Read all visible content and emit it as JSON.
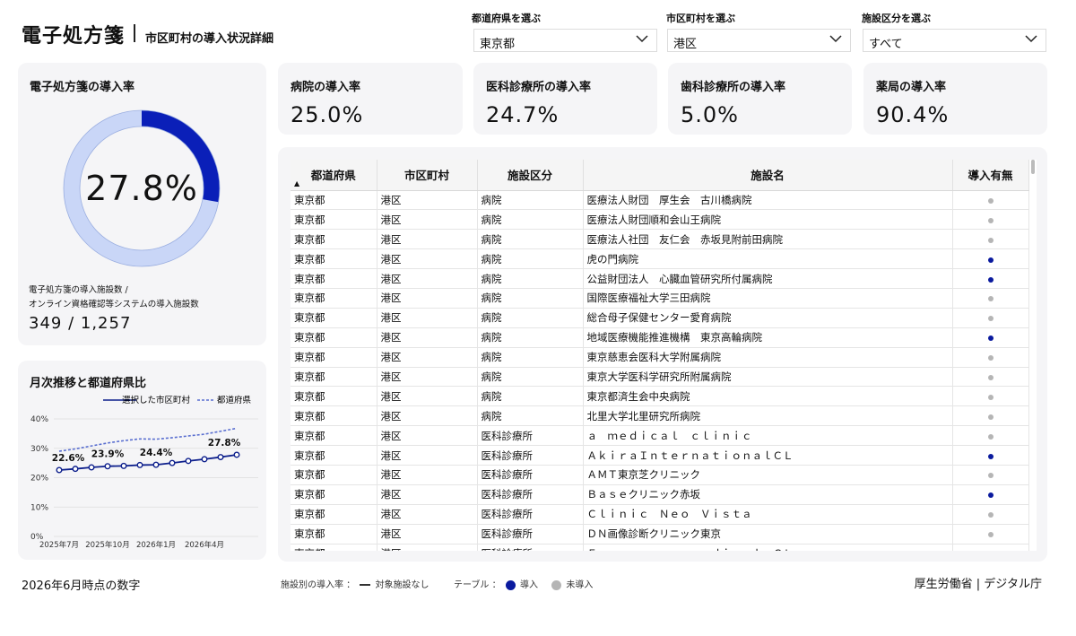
{
  "header": {
    "title": "電子処方箋",
    "subtitle": "市区町村の導入状況詳細"
  },
  "filters": [
    {
      "label": "都道府県を選ぶ",
      "value": "東京都"
    },
    {
      "label": "市区町村を選ぶ",
      "value": "港区"
    },
    {
      "label": "施設区分を選ぶ",
      "value": "すべて"
    }
  ],
  "overall": {
    "title": "電子処方箋の導入率",
    "rate": "27.8%",
    "rate_fraction": 0.278,
    "caption_line1": "電子処方箋の導入施設数 /",
    "caption_line2": "オンライン資格確認等システムの導入施設数",
    "counts": "349 / 1,257"
  },
  "kpis": [
    {
      "title": "病院の導入率",
      "value": "25.0%"
    },
    {
      "title": "医科診療所の導入率",
      "value": "24.7%"
    },
    {
      "title": "歯科診療所の導入率",
      "value": "5.0%"
    },
    {
      "title": "薬局の導入率",
      "value": "90.4%"
    }
  ],
  "trend": {
    "title": "月次推移と都道府県比",
    "legend_selected": "選択した市区町村",
    "legend_pref": "都道府県"
  },
  "chart_data": {
    "type": "line",
    "x": [
      "2025年7月",
      "2025年8月",
      "2025年9月",
      "2025年10月",
      "2025年11月",
      "2025年12月",
      "2026年1月",
      "2026年2月",
      "2026年3月",
      "2026年4月",
      "2026年5月",
      "2026年6月"
    ],
    "x_tick_labels": [
      "2025年7月",
      "2025年10月",
      "2026年1月",
      "2026年4月"
    ],
    "y_tick_labels": [
      "0%",
      "10%",
      "20%",
      "30%",
      "40%"
    ],
    "ylim": [
      0,
      40
    ],
    "series": [
      {
        "name": "選択した市区町村",
        "values": [
          22.6,
          23.0,
          23.5,
          23.9,
          24.0,
          24.3,
          24.4,
          25.0,
          25.7,
          26.3,
          27.0,
          27.8
        ],
        "color": "#0d1f8c"
      },
      {
        "name": "都道府県",
        "values": [
          29.0,
          29.8,
          30.8,
          31.8,
          32.6,
          33.2,
          33.1,
          33.6,
          34.2,
          34.8,
          35.8,
          36.8
        ],
        "color": "#5a6fd0"
      }
    ],
    "point_labels": [
      {
        "index": 0,
        "text": "22.6%"
      },
      {
        "index": 3,
        "text": "23.9%"
      },
      {
        "index": 6,
        "text": "24.4%"
      },
      {
        "index": 11,
        "text": "27.8%"
      }
    ]
  },
  "table": {
    "headers": [
      "都道府県",
      "市区町村",
      "施設区分",
      "施設名",
      "導入有無"
    ],
    "sort_indicator": "▲",
    "rows": [
      [
        "東京都",
        "港区",
        "病院",
        "医療法人財団　厚生会　古川橋病院",
        false
      ],
      [
        "東京都",
        "港区",
        "病院",
        "医療法人財団順和会山王病院",
        false
      ],
      [
        "東京都",
        "港区",
        "病院",
        "医療法人社団　友仁会　赤坂見附前田病院",
        false
      ],
      [
        "東京都",
        "港区",
        "病院",
        "虎の門病院",
        true
      ],
      [
        "東京都",
        "港区",
        "病院",
        "公益財団法人　心臓血管研究所付属病院",
        true
      ],
      [
        "東京都",
        "港区",
        "病院",
        "国際医療福祉大学三田病院",
        false
      ],
      [
        "東京都",
        "港区",
        "病院",
        "総合母子保健センター愛育病院",
        false
      ],
      [
        "東京都",
        "港区",
        "病院",
        "地域医療機能推進機構　東京高輪病院",
        true
      ],
      [
        "東京都",
        "港区",
        "病院",
        "東京慈恵会医科大学附属病院",
        false
      ],
      [
        "東京都",
        "港区",
        "病院",
        "東京大学医科学研究所附属病院",
        false
      ],
      [
        "東京都",
        "港区",
        "病院",
        "東京都済生会中央病院",
        false
      ],
      [
        "東京都",
        "港区",
        "病院",
        "北里大学北里研究所病院",
        false
      ],
      [
        "東京都",
        "港区",
        "医科診療所",
        "ａ　ｍｅｄｉｃａｌ　ｃｌｉｎｉｃ",
        false
      ],
      [
        "東京都",
        "港区",
        "医科診療所",
        "ＡｋｉｒａＩｎｔｅｒｎａｔｉｏｎａｌＣＬ",
        true
      ],
      [
        "東京都",
        "港区",
        "医科診療所",
        "ＡＭＴ東京芝クリニック",
        false
      ],
      [
        "東京都",
        "港区",
        "医科診療所",
        "Ｂａｓｅクリニック赤坂",
        true
      ],
      [
        "東京都",
        "港区",
        "医科診療所",
        "Ｃｌｉｎｉｃ　Ｎｅｏ　Ｖｉｓｔａ",
        false
      ],
      [
        "東京都",
        "港区",
        "医科診療所",
        "ＤＮ画像診断クリニック東京",
        false
      ],
      [
        "東京都",
        "港区",
        "医科診療所",
        "Ｅｖｅｒｇｒｅｅｎ　ｍｅｄｉｃａｌ　ＣＬ",
        false
      ]
    ]
  },
  "colors": {
    "introduced": "#0a1a9e",
    "not_introduced": "#b5b5b5",
    "donut_fill": "#0a1fb8",
    "donut_track": "#c9d6f7"
  },
  "footer": {
    "as_of": "2026年6月時点の数字",
    "legend_rate_label": "施設別の導入率 ：",
    "legend_none": "対象施設なし",
    "legend_table_label": "テーブル ：",
    "legend_yes": "導入",
    "legend_no": "未導入",
    "source": "厚生労働省 | デジタル庁"
  }
}
